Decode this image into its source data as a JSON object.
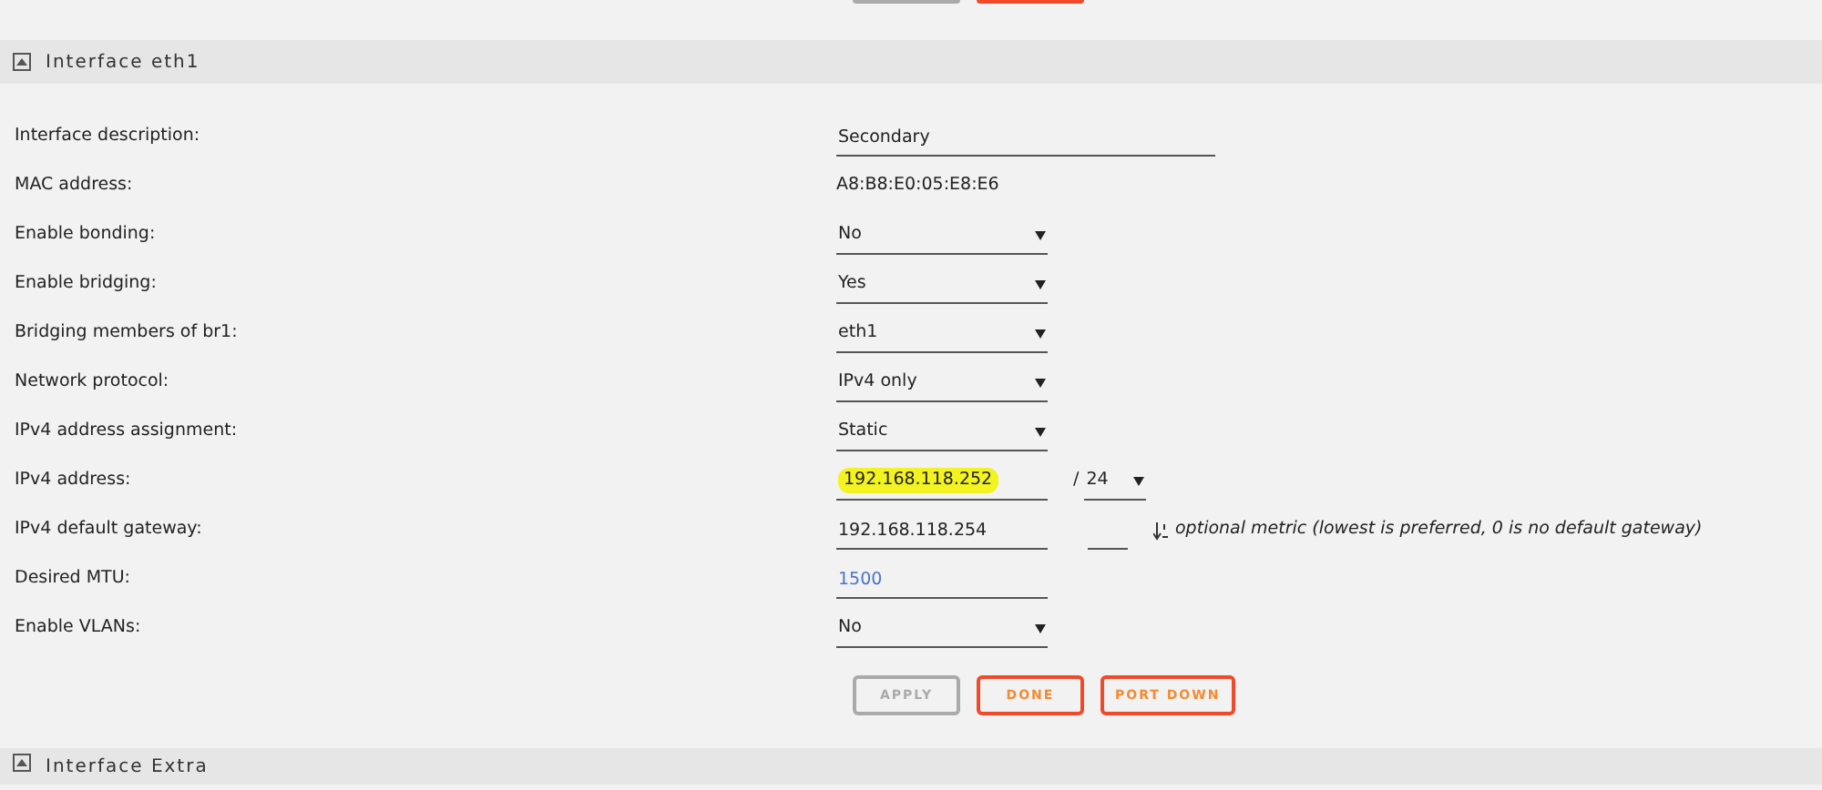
{
  "section": {
    "title": "Interface eth1"
  },
  "fields": [
    {
      "kind": "text",
      "label": "Interface description:",
      "value": "Secondary"
    },
    {
      "kind": "static",
      "label": "MAC address:",
      "value": "A8:B8:E0:05:E8:E6"
    },
    {
      "kind": "select",
      "label": "Enable bonding:",
      "value": "No"
    },
    {
      "kind": "select",
      "label": "Enable bridging:",
      "value": "Yes"
    },
    {
      "kind": "select",
      "label": "Bridging members of br1:",
      "value": "eth1"
    },
    {
      "kind": "select",
      "label": "Network protocol:",
      "value": "IPv4 only"
    },
    {
      "kind": "select",
      "label": "IPv4 address assignment:",
      "value": "Static"
    },
    {
      "kind": "address",
      "label": "IPv4 address:",
      "value": "192.168.118.252",
      "highlighted": true,
      "separator": "/",
      "prefix": "24"
    },
    {
      "kind": "gateway",
      "label": "IPv4 default gateway:",
      "value": "192.168.118.254",
      "hint": "optional metric (lowest is preferred, 0 is no default gateway)"
    },
    {
      "kind": "short",
      "label": "Desired MTU:",
      "placeholder": "1500"
    },
    {
      "kind": "select",
      "label": "Enable VLANs:",
      "value": "No"
    }
  ],
  "buttons": [
    {
      "label": "APPLY",
      "disabled": true
    },
    {
      "label": "DONE",
      "disabled": false
    },
    {
      "label": "PORT DOWN",
      "disabled": false
    }
  ],
  "next_section": {
    "title": "Interface Extra"
  }
}
